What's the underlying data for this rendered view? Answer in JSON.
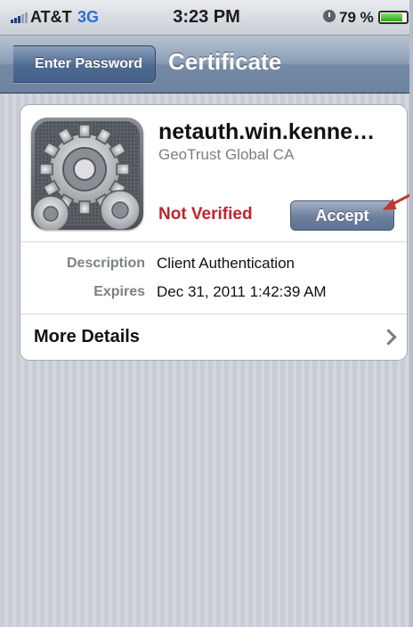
{
  "status_bar": {
    "carrier": "AT&T",
    "network": "3G",
    "time": "3:23 PM",
    "battery_percent": "79 %",
    "battery_level": 0.79,
    "icons": [
      "signal-icon",
      "alarm-icon",
      "battery-icon"
    ]
  },
  "nav": {
    "back_label": "Enter Password",
    "title": "Certificate"
  },
  "certificate": {
    "name": "netauth.win.kenne…",
    "issuer": "GeoTrust Global CA",
    "status": "Not Verified",
    "accept_label": "Accept",
    "icon": "settings-gears-icon",
    "rows": [
      {
        "label": "Description",
        "value": "Client Authentication"
      },
      {
        "label": "Expires",
        "value": "Dec 31, 2011 1:42:39 AM"
      }
    ],
    "more_details_label": "More Details"
  },
  "colors": {
    "status_red": "#c2232b",
    "nav_blue": "#6d83a0",
    "annotation_arrow": "#c0392b"
  }
}
